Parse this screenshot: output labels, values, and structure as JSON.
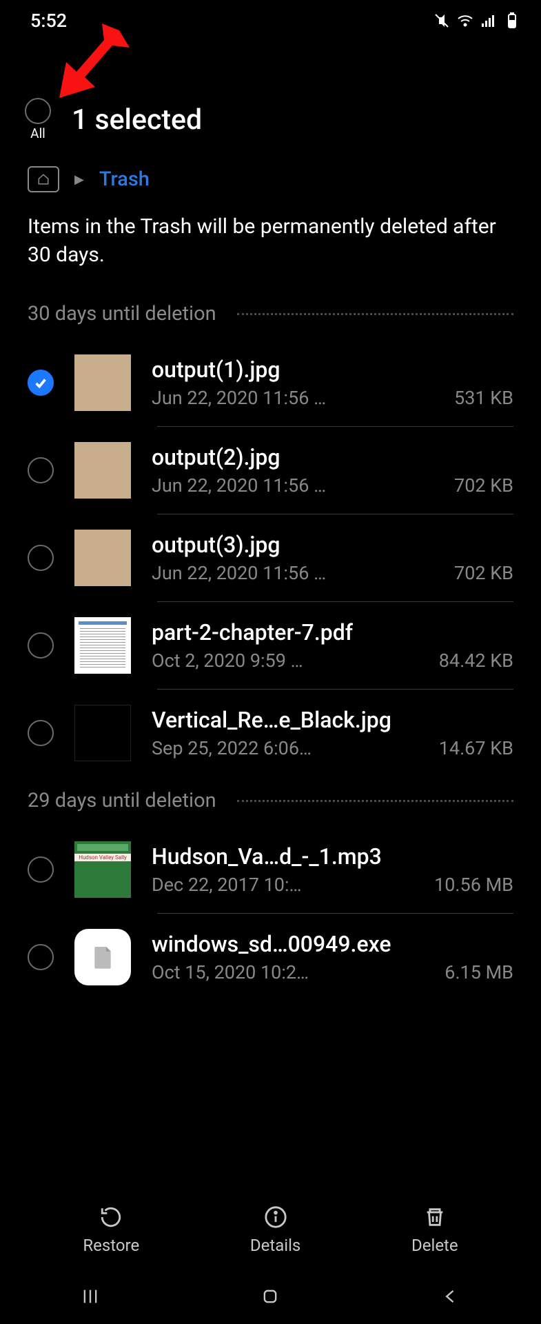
{
  "status": {
    "time": "5:52"
  },
  "header": {
    "all_label": "All",
    "selected_text": "1 selected"
  },
  "breadcrumb": {
    "current": "Trash"
  },
  "notice": "Items in the Trash will be permanently deleted after 30 days.",
  "sections": [
    {
      "label": "30 days until deletion",
      "files": [
        {
          "name": "output(1).jpg",
          "date": "Jun 22, 2020 11:56 …",
          "size": "531 KB",
          "checked": true,
          "thumb": "sepia"
        },
        {
          "name": "output(2).jpg",
          "date": "Jun 22, 2020 11:56 …",
          "size": "702 KB",
          "checked": false,
          "thumb": "sepia"
        },
        {
          "name": "output(3).jpg",
          "date": "Jun 22, 2020 11:56 …",
          "size": "702 KB",
          "checked": false,
          "thumb": "sepia"
        },
        {
          "name": "part-2-chapter-7.pdf",
          "date": "Oct 2, 2020 9:59 …",
          "size": "84.42 KB",
          "checked": false,
          "thumb": "doc"
        },
        {
          "name": "Vertical_Re…e_Black.jpg",
          "date": "Sep 25, 2022 6:06…",
          "size": "14.67 KB",
          "checked": false,
          "thumb": "black"
        }
      ]
    },
    {
      "label": "29 days until deletion",
      "files": [
        {
          "name": "Hudson_Va…d_-_1.mp3",
          "date": "Dec 22, 2017 10:…",
          "size": "10.56 MB",
          "checked": false,
          "thumb": "hudson"
        },
        {
          "name": "windows_sd…00949.exe",
          "date": "Oct 15, 2020 10:2…",
          "size": "6.15 MB",
          "checked": false,
          "thumb": "exe"
        }
      ]
    }
  ],
  "actions": {
    "restore": "Restore",
    "details": "Details",
    "delete": "Delete"
  }
}
